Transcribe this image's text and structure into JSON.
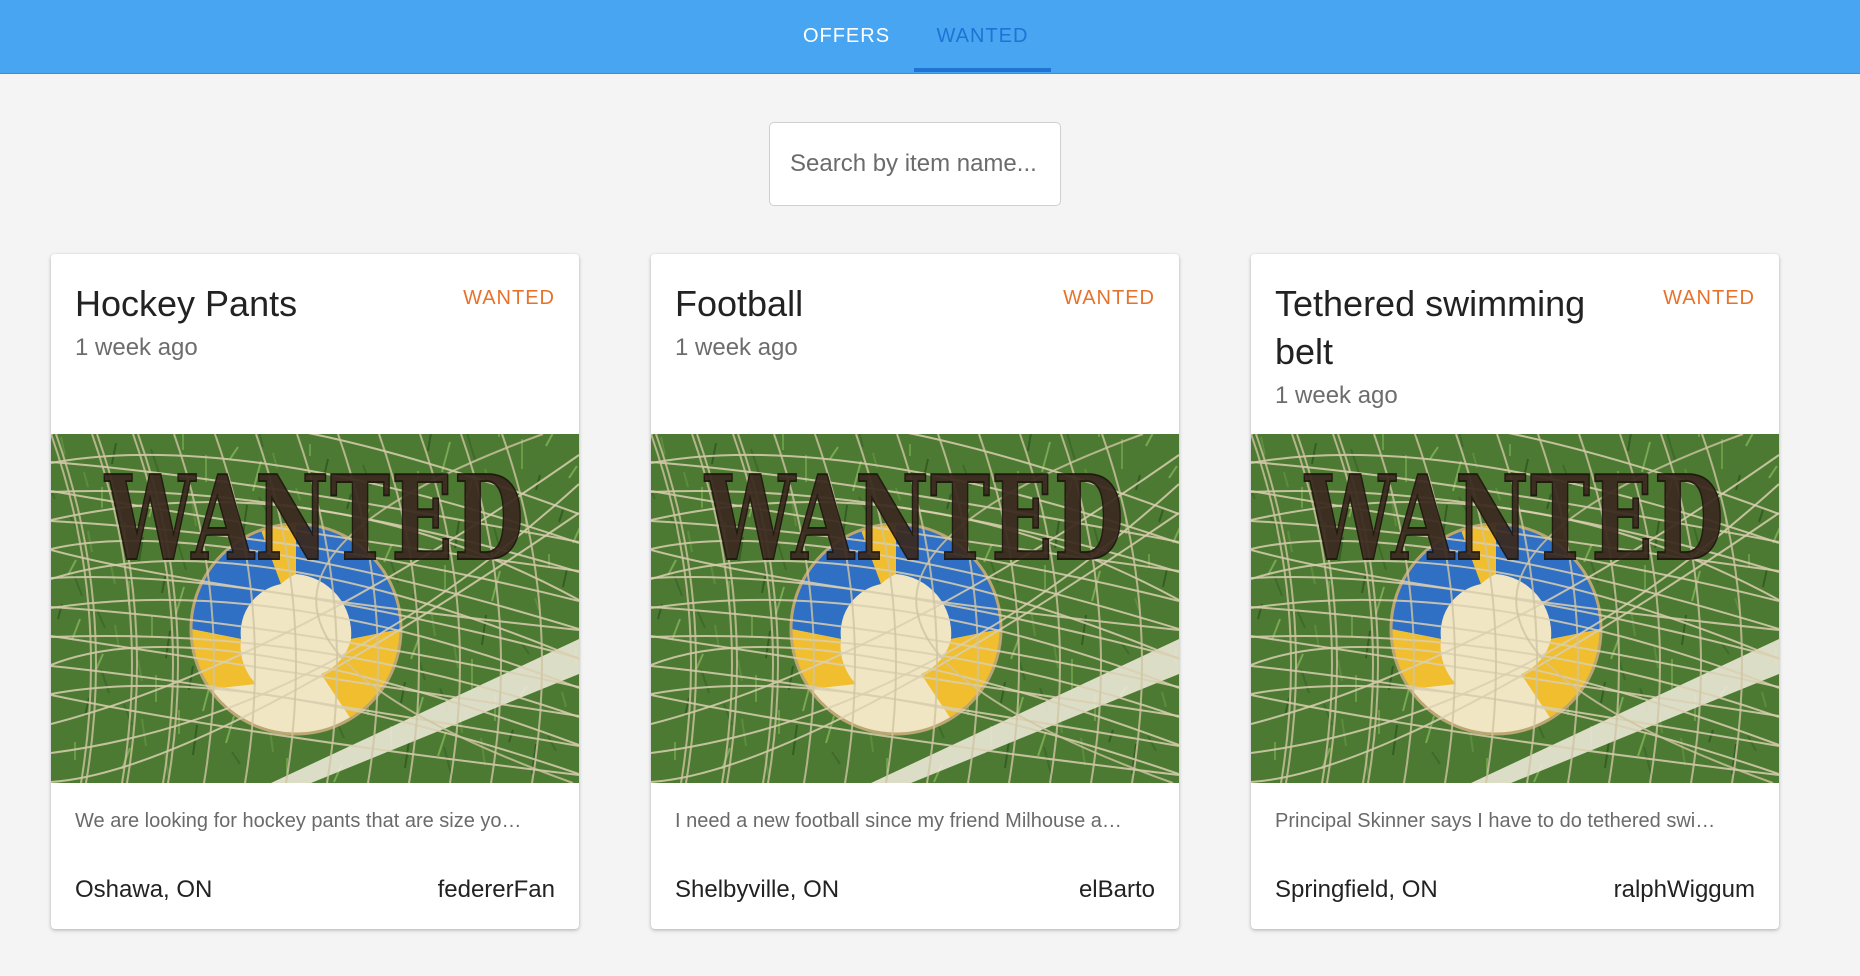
{
  "tabs": {
    "offers_label": "OFFERS",
    "wanted_label": "WANTED",
    "active": "WANTED"
  },
  "search": {
    "placeholder": "Search by item name...",
    "value": ""
  },
  "colors": {
    "app_bar": "#48a5f2",
    "active_tab": "#1f73d3",
    "badge": "#e6722c",
    "background": "#f4f4f4"
  },
  "cards": [
    {
      "title": "Hockey Pants",
      "time": "1 week ago",
      "badge": "WANTED",
      "image_overlay_text": "WANTED",
      "description": "We are looking for hockey pants that are size yo…",
      "location": "Oshawa, ON",
      "user": "federerFan"
    },
    {
      "title": "Football",
      "time": "1 week ago",
      "badge": "WANTED",
      "image_overlay_text": "WANTED",
      "description": "I need a new football since my friend Milhouse a…",
      "location": "Shelbyville, ON",
      "user": "elBarto"
    },
    {
      "title": "Tethered swimming belt",
      "time": "1 week ago",
      "badge": "WANTED",
      "image_overlay_text": "WANTED",
      "description": "Principal Skinner says I have to do tethered swi…",
      "location": "Springfield, ON",
      "user": "ralphWiggum"
    }
  ]
}
